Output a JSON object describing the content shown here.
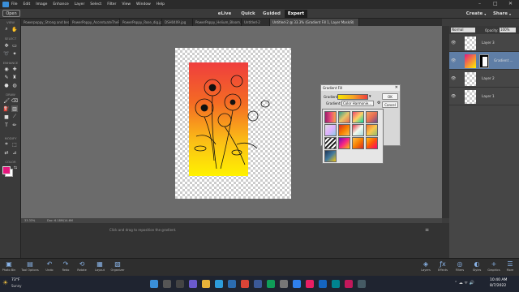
{
  "menubar": {
    "items": [
      "File",
      "Edit",
      "Image",
      "Enhance",
      "Layer",
      "Select",
      "Filter",
      "View",
      "Window",
      "Help"
    ]
  },
  "modebar": {
    "open_label": "Open",
    "modes": [
      "eLive",
      "Quick",
      "Guided",
      "Expert"
    ],
    "active_mode": "Expert",
    "create_label": "Create",
    "share_label": "Share"
  },
  "tabs": [
    "Powerpoppy_Strong and beautiful 21.jpg",
    "PowerPoppy_AccentuateThePositive_dig_300 22.jpg",
    "PowerPoppy_Rose_dig.jpg",
    "DSH0409.jpg",
    "PowerPoppy_Helium_Bloom_dig.jpg",
    "Untitled-2",
    "Untitled-2 @ 33.3% (Gradient Fill 1, Layer Mask/8)"
  ],
  "toolbar": {
    "sections": [
      "VIEW",
      "SELECT",
      "ENHANCE",
      "DRAW",
      "MODIFY",
      "COLOR"
    ],
    "colors": {
      "foreground": "#e6177d",
      "background": "#ffffff"
    }
  },
  "layers_panel": {
    "blend_mode": "Normal",
    "opacity_label": "Opacity:",
    "opacity_value": "100%",
    "layers": [
      {
        "name": "Layer 3",
        "selected": false
      },
      {
        "name": "Gradient ...",
        "selected": true
      },
      {
        "name": "Layer 2",
        "selected": false
      },
      {
        "name": "Layer 1",
        "selected": false
      }
    ]
  },
  "status": {
    "zoom": "33.33%",
    "doc_size": "Doc: 6.18M/14.6M",
    "hint": "Click and drag to reposition the gradient."
  },
  "gradient_dialog": {
    "title": "Gradient Fill",
    "gradient_label": "Gradient:",
    "ok_label": "OK",
    "cancel_label": "Cancel",
    "picker_label": "Gradient:",
    "picker_set": "Color Harmonie..."
  },
  "bottombar": {
    "left": [
      "Photo Bin",
      "Tool Options",
      "Undo",
      "Redo",
      "Rotate",
      "Layout",
      "Organizer"
    ],
    "right": [
      "Layers",
      "Effects",
      "Filters",
      "Styles",
      "Graphics",
      "More"
    ]
  },
  "taskbar": {
    "weather_temp": "73°F",
    "weather_desc": "Sunny",
    "time": "10:40 AM",
    "date": "8/7/2022"
  }
}
